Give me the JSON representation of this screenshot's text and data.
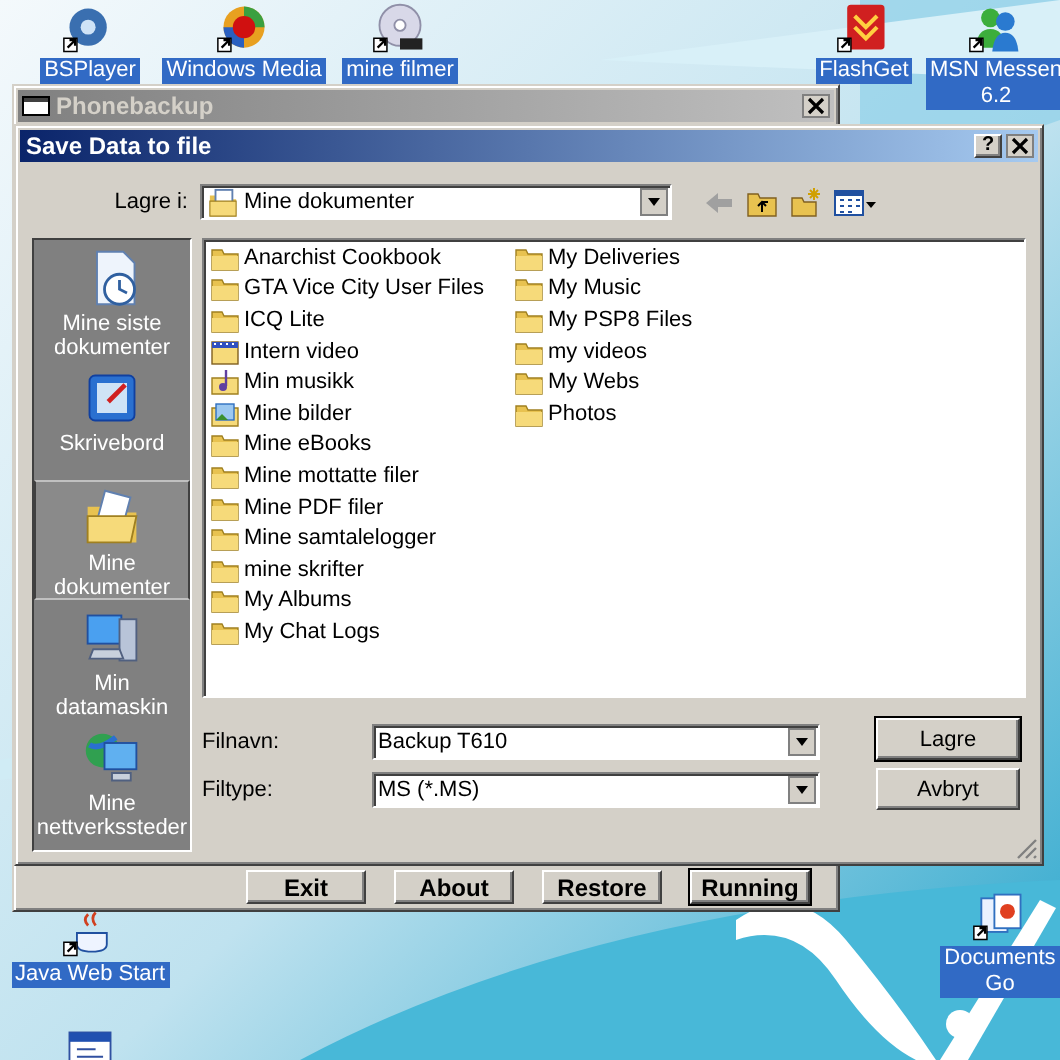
{
  "desktop_icons": [
    {
      "kind": "player",
      "lines": [
        "BSPlayer"
      ]
    },
    {
      "kind": "media",
      "lines": [
        "Windows Media"
      ]
    },
    {
      "kind": "dvd",
      "lines": [
        "mine filmer"
      ]
    },
    {
      "kind": "download",
      "lines": [
        "FlashGet"
      ]
    },
    {
      "kind": "messenger",
      "lines": [
        "MSN Messen",
        "6.2"
      ]
    },
    {
      "kind": "java",
      "lines": [
        "Java Web Start"
      ]
    },
    {
      "kind": "documents",
      "lines": [
        "Documents",
        "Go"
      ]
    },
    {
      "kind": "program"
    }
  ],
  "app_window": {
    "title": "Phonebackup",
    "buttons": [
      {
        "label": "Exit",
        "default": false
      },
      {
        "label": "About",
        "default": false
      },
      {
        "label": "Restore",
        "default": false
      },
      {
        "label": "Running",
        "default": true
      }
    ]
  },
  "dialog": {
    "title": "Save Data to file",
    "help_button": "?",
    "look_in": {
      "label": "Lagre i:",
      "value": "Mine dokumenter"
    },
    "places": [
      {
        "kind": "recent",
        "label": "Mine siste dokumenter",
        "selected": false
      },
      {
        "kind": "desktop",
        "label": "Skrivebord",
        "selected": false
      },
      {
        "kind": "documents",
        "label": "Mine dokumenter",
        "selected": true
      },
      {
        "kind": "computer",
        "label": "Min datamaskin",
        "selected": false
      },
      {
        "kind": "network",
        "label": "Mine nettverkssteder",
        "selected": false
      }
    ],
    "files": [
      {
        "kind": "folder",
        "name": "Anarchist Cookbook"
      },
      {
        "kind": "folder",
        "name": "GTA Vice City User Files"
      },
      {
        "kind": "folder",
        "name": "ICQ Lite"
      },
      {
        "kind": "video",
        "name": "Intern video"
      },
      {
        "kind": "music",
        "name": "Min musikk"
      },
      {
        "kind": "pictures",
        "name": "Mine bilder"
      },
      {
        "kind": "folder",
        "name": "Mine eBooks"
      },
      {
        "kind": "folder",
        "name": "Mine mottatte filer"
      },
      {
        "kind": "folder",
        "name": "Mine PDF filer"
      },
      {
        "kind": "folder",
        "name": "Mine samtalelogger"
      },
      {
        "kind": "folder",
        "name": "mine skrifter"
      },
      {
        "kind": "folder",
        "name": "My Albums"
      },
      {
        "kind": "folder",
        "name": "My Chat Logs"
      },
      {
        "kind": "folder",
        "name": "My Deliveries"
      },
      {
        "kind": "folder",
        "name": "My Music"
      },
      {
        "kind": "folder",
        "name": "My PSP8 Files"
      },
      {
        "kind": "folder",
        "name": "my videos"
      },
      {
        "kind": "folder",
        "name": "My Webs"
      },
      {
        "kind": "folder",
        "name": "Photos"
      }
    ],
    "file_name": {
      "label": "Filnavn:",
      "value": "Backup T610"
    },
    "file_type": {
      "label": "Filtype:",
      "value": "MS (*.MS)"
    },
    "buttons": [
      {
        "label": "Lagre",
        "default": true
      },
      {
        "label": "Avbryt",
        "default": false
      }
    ]
  }
}
